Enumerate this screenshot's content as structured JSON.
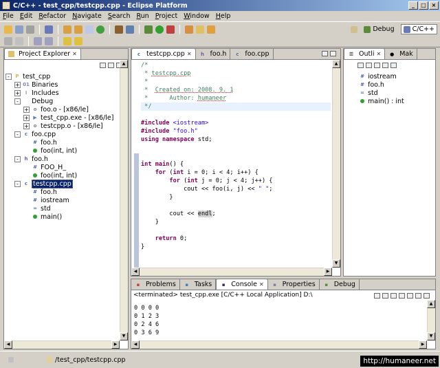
{
  "window": {
    "title": "C/C++ - test_cpp/testcpp.cpp - Eclipse Platform"
  },
  "menu": [
    "File",
    "Edit",
    "Refactor",
    "Navigate",
    "Search",
    "Run",
    "Project",
    "Window",
    "Help"
  ],
  "perspectives": {
    "debug": "Debug",
    "cpp": "C/C++"
  },
  "project_explorer": {
    "title": "Project Explorer",
    "tree": [
      {
        "label": "test_cpp",
        "level": 0,
        "exp": "-",
        "icon": "project-icon"
      },
      {
        "label": "Binaries",
        "level": 1,
        "exp": "+",
        "icon": "binaries-icon"
      },
      {
        "label": "Includes",
        "level": 1,
        "exp": "+",
        "icon": "includes-icon"
      },
      {
        "label": "Debug",
        "level": 1,
        "exp": "-",
        "icon": "folder-icon"
      },
      {
        "label": "foo.o - [x86/le]",
        "level": 2,
        "exp": "+",
        "icon": "object-icon"
      },
      {
        "label": "test_cpp.exe - [x86/le]",
        "level": 2,
        "exp": "+",
        "icon": "exe-icon"
      },
      {
        "label": "testcpp.o - [x86/le]",
        "level": 2,
        "exp": "+",
        "icon": "object-icon"
      },
      {
        "label": "foo.cpp",
        "level": 1,
        "exp": "-",
        "icon": "cpp-file-icon"
      },
      {
        "label": "foo.h",
        "level": 2,
        "exp": "",
        "icon": "include-icon"
      },
      {
        "label": "foo(int, int)",
        "level": 2,
        "exp": "",
        "icon": "function-icon"
      },
      {
        "label": "foo.h",
        "level": 1,
        "exp": "-",
        "icon": "h-file-icon"
      },
      {
        "label": "FOO_H_",
        "level": 2,
        "exp": "",
        "icon": "macro-icon"
      },
      {
        "label": "foo(int, int)",
        "level": 2,
        "exp": "",
        "icon": "declaration-icon"
      },
      {
        "label": "testcpp.cpp",
        "level": 1,
        "exp": "-",
        "icon": "cpp-file-icon",
        "selected": true
      },
      {
        "label": "foo.h",
        "level": 2,
        "exp": "",
        "icon": "include-icon"
      },
      {
        "label": "iostream",
        "level": 2,
        "exp": "",
        "icon": "include-icon"
      },
      {
        "label": "std",
        "level": 2,
        "exp": "",
        "icon": "namespace-icon"
      },
      {
        "label": "main()",
        "level": 2,
        "exp": "",
        "icon": "function-icon"
      }
    ]
  },
  "editor": {
    "tabs": [
      {
        "label": "testcpp.cpp",
        "active": true,
        "closable": true
      },
      {
        "label": "foo.h",
        "active": false
      },
      {
        "label": "foo.cpp",
        "active": false
      }
    ],
    "lines": [
      [
        {
          "c": "cm",
          "t": "/*"
        }
      ],
      [
        {
          "c": "cm",
          "t": " * "
        },
        {
          "c": "cmu",
          "t": "testcpp.cpp"
        }
      ],
      [
        {
          "c": "cm",
          "t": " *"
        }
      ],
      [
        {
          "c": "cm",
          "t": " *  "
        },
        {
          "c": "cmu",
          "t": "Created on: 2008. 9. 1"
        }
      ],
      [
        {
          "c": "cm",
          "t": " *      Author: "
        },
        {
          "c": "cmu",
          "t": "humaneer"
        }
      ],
      [
        {
          "c": "cm",
          "t": " */"
        }
      ],
      [
        {
          "c": "",
          "t": ""
        }
      ],
      [
        {
          "c": "pp",
          "t": "#include "
        },
        {
          "c": "st",
          "t": "<iostream>"
        }
      ],
      [
        {
          "c": "pp",
          "t": "#include "
        },
        {
          "c": "st",
          "t": "\"foo.h\""
        }
      ],
      [
        {
          "c": "kw",
          "t": "using namespace"
        },
        {
          "c": "",
          "t": " std;"
        }
      ],
      [
        {
          "c": "",
          "t": ""
        }
      ],
      [
        {
          "c": "",
          "t": ""
        }
      ],
      [
        {
          "c": "kw",
          "t": "int"
        },
        {
          "c": "",
          "t": " "
        },
        {
          "c": "kw",
          "t": "main"
        },
        {
          "c": "",
          "t": "() {"
        }
      ],
      [
        {
          "c": "",
          "t": "    "
        },
        {
          "c": "kw",
          "t": "for"
        },
        {
          "c": "",
          "t": " ("
        },
        {
          "c": "kw",
          "t": "int"
        },
        {
          "c": "",
          "t": " i = 0; i < 4; i++) {"
        }
      ],
      [
        {
          "c": "",
          "t": "        "
        },
        {
          "c": "kw",
          "t": "for"
        },
        {
          "c": "",
          "t": " ("
        },
        {
          "c": "kw",
          "t": "int"
        },
        {
          "c": "",
          "t": " j = 0; j < 4; j++) {"
        }
      ],
      [
        {
          "c": "",
          "t": "            cout << foo(i, j) << "
        },
        {
          "c": "st",
          "t": "\" \""
        },
        {
          "c": "",
          "t": ";"
        }
      ],
      [
        {
          "c": "",
          "t": "        }"
        }
      ],
      [
        {
          "c": "",
          "t": ""
        }
      ],
      [
        {
          "c": "",
          "t": "        cout << "
        },
        {
          "c": "hl",
          "t": "endl"
        },
        {
          "c": "",
          "t": ";"
        }
      ],
      [
        {
          "c": "",
          "t": "    }"
        }
      ],
      [
        {
          "c": "",
          "t": ""
        }
      ],
      [
        {
          "c": "",
          "t": "    "
        },
        {
          "c": "kw",
          "t": "return"
        },
        {
          "c": "",
          "t": " 0;"
        }
      ],
      [
        {
          "c": "",
          "t": "}"
        }
      ]
    ]
  },
  "outline": {
    "tabs": [
      {
        "label": "Outli",
        "active": true
      },
      {
        "label": "Mak",
        "active": false
      }
    ],
    "items": [
      {
        "label": "iostream",
        "icon": "include-icon"
      },
      {
        "label": "foo.h",
        "icon": "include-icon"
      },
      {
        "label": "std",
        "icon": "namespace-icon"
      },
      {
        "label": "main() : int",
        "icon": "function-icon"
      }
    ]
  },
  "bottom": {
    "tabs": [
      {
        "label": "Problems",
        "active": false
      },
      {
        "label": "Tasks",
        "active": false
      },
      {
        "label": "Console",
        "active": true
      },
      {
        "label": "Properties",
        "active": false
      },
      {
        "label": "Debug",
        "active": false
      }
    ],
    "console_header": "<terminated> test_cpp.exe [C/C++ Local Application] D:\\",
    "output": [
      "0 0 0 0",
      "0 1 2 3",
      "0 2 4 6",
      "0 3 6 9"
    ]
  },
  "status": {
    "path": "/test_cpp/testcpp.cpp"
  },
  "watermark": "http://humaneer.net",
  "colors": {
    "keyword": "#7f0055",
    "comment": "#3f7f5f",
    "string": "#2a00ff",
    "selection": "#0a246a"
  }
}
